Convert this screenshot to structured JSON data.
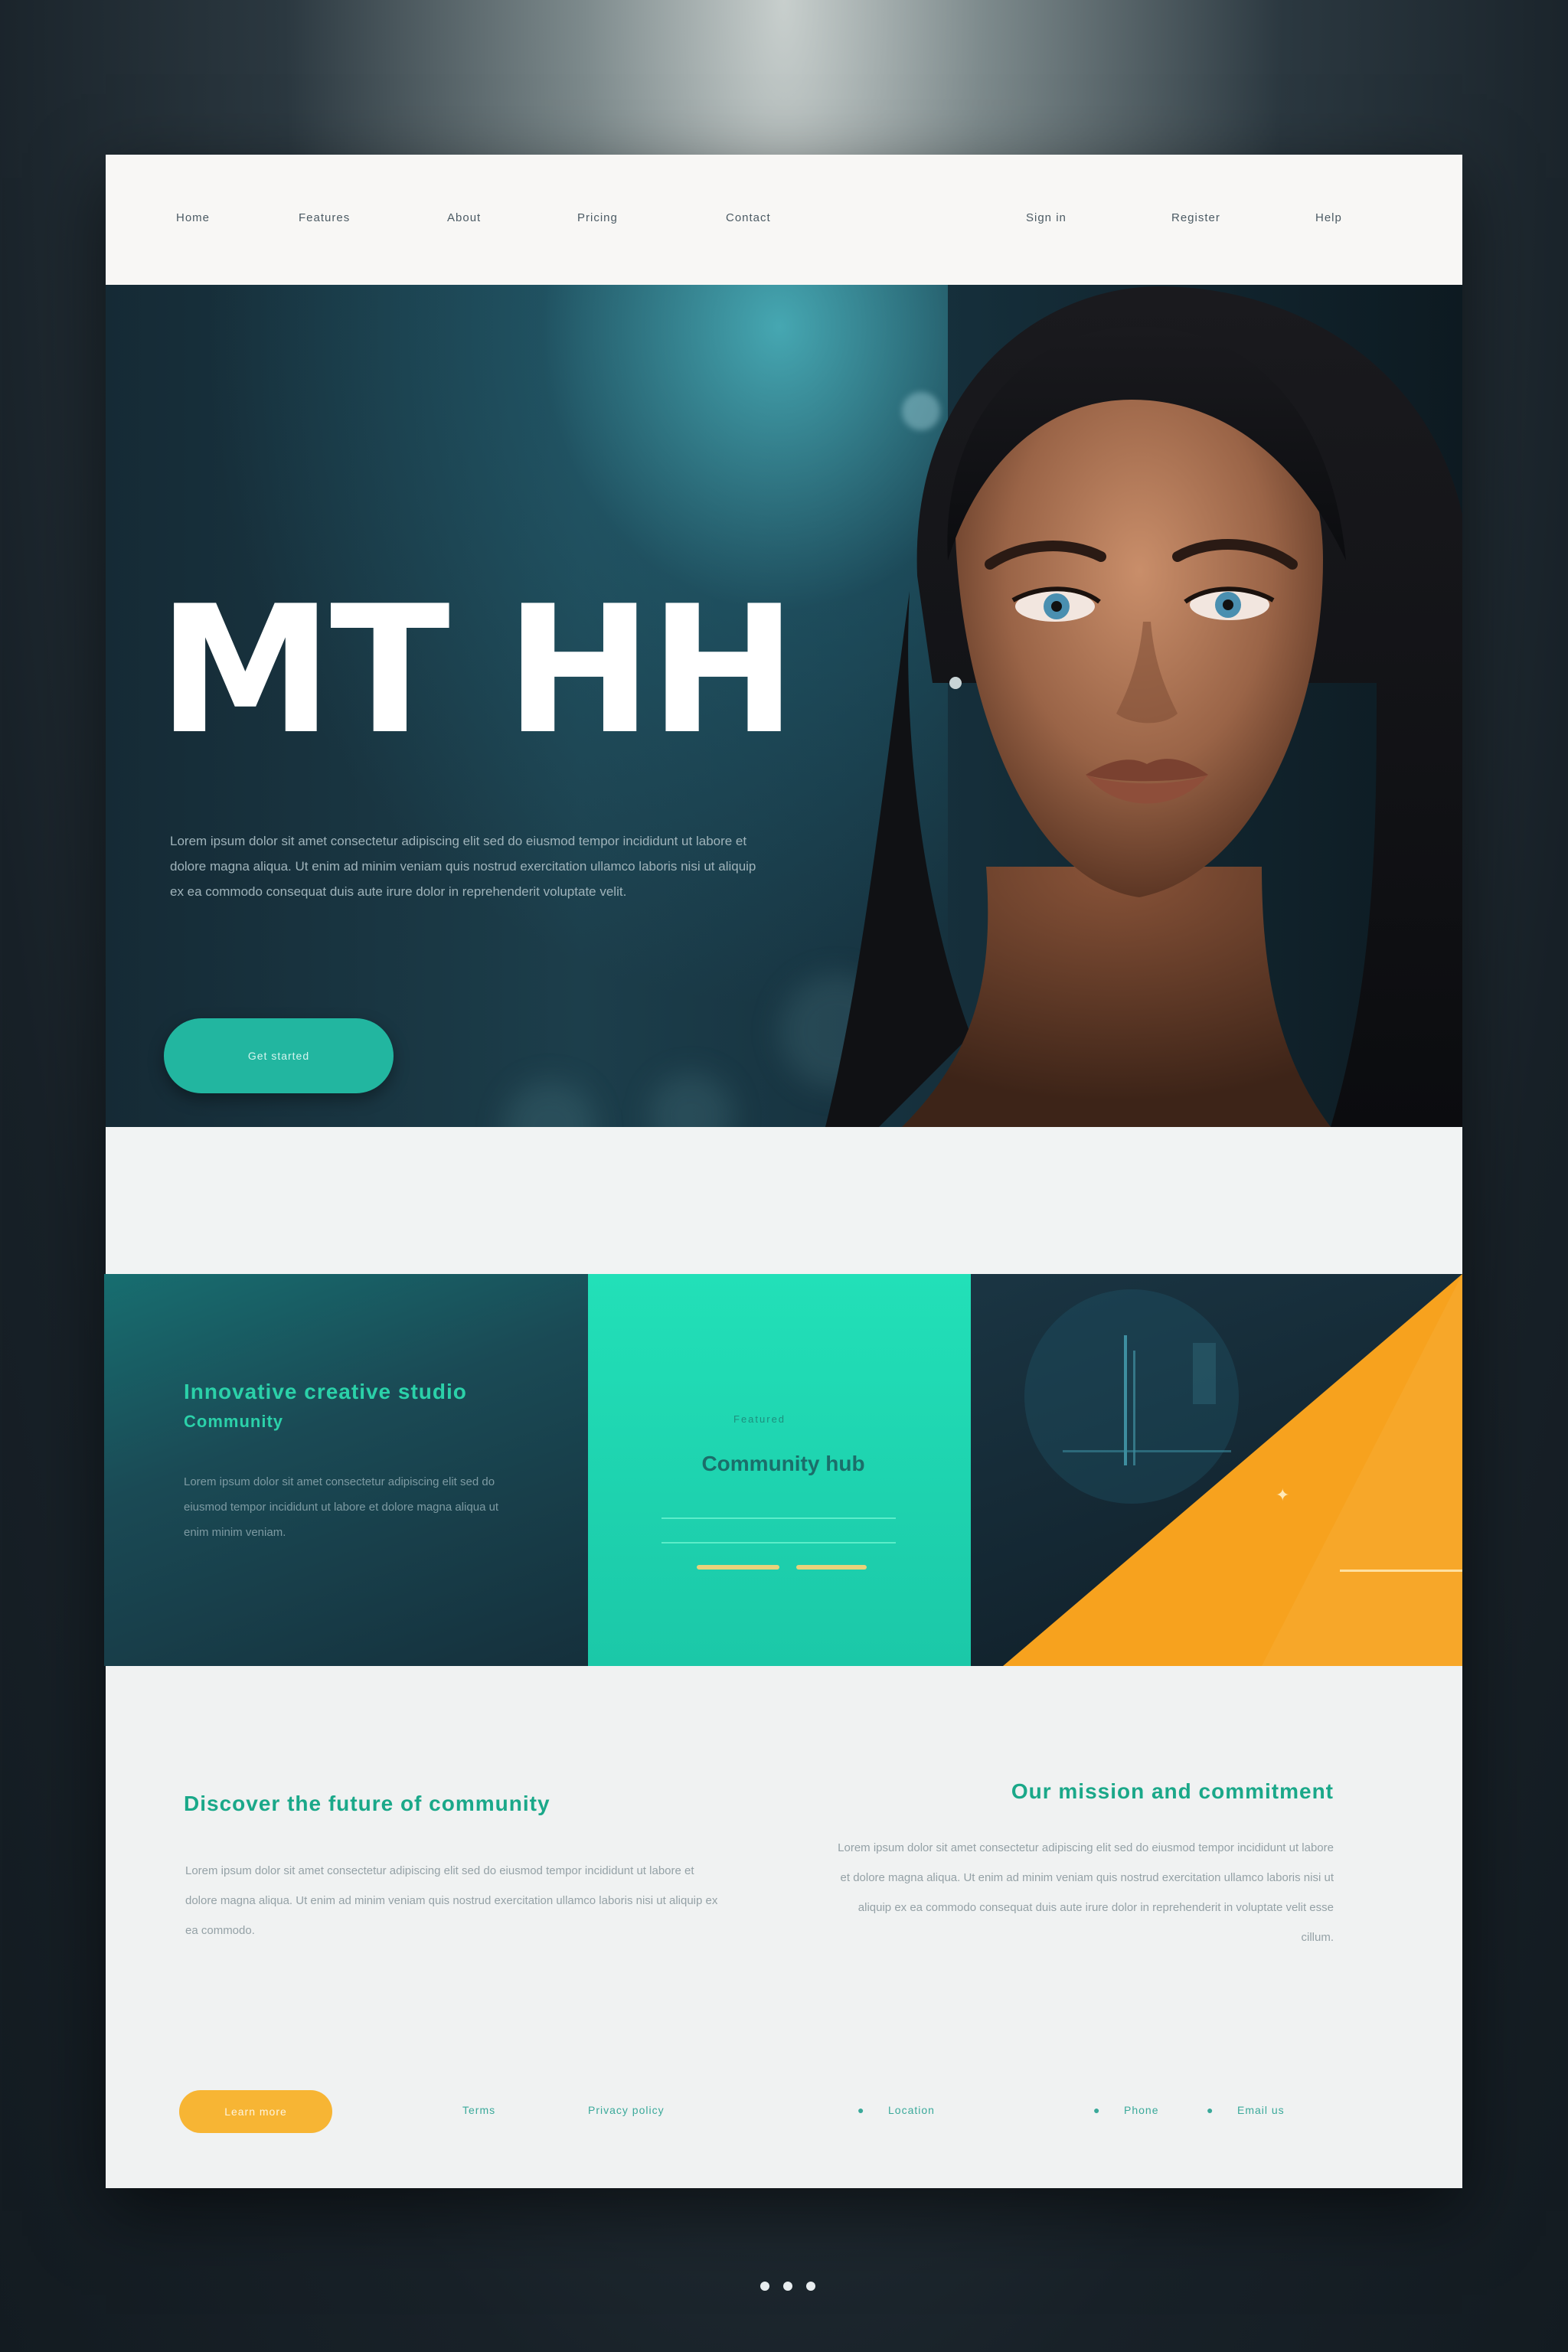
{
  "nav": {
    "left_items": [
      "Home",
      "Features",
      "About",
      "Pricing",
      "Contact"
    ],
    "right_items": [
      "Sign in",
      "Register",
      "Help"
    ]
  },
  "hero": {
    "title": "MT HH",
    "paragraph": "Lorem ipsum dolor sit amet consectetur adipiscing elit sed do eiusmod tempor incididunt ut labore et dolore magna aliqua. Ut enim ad minim veniam quis nostrud exercitation ullamco laboris nisi ut aliquip ex ea commodo consequat duis aute irure dolor in reprehenderit voluptate velit.",
    "cta_label": "Get started"
  },
  "cards": {
    "card1": {
      "title": "Innovative creative studio",
      "subtitle": "Community",
      "text": "Lorem ipsum dolor sit amet consectetur adipiscing elit sed do eiusmod tempor incididunt ut labore et dolore magna aliqua ut enim minim veniam."
    },
    "card2": {
      "kicker": "Featured",
      "title": "Community hub"
    },
    "card3": {
      "mark": "✦"
    }
  },
  "bottom": {
    "left_title": "Discover the future of community",
    "left_text": "Lorem ipsum dolor sit amet consectetur adipiscing elit sed do eiusmod tempor incididunt ut labore et dolore magna aliqua. Ut enim ad minim veniam quis nostrud exercitation ullamco laboris nisi ut aliquip ex ea commodo.",
    "right_title": "Our mission and commitment",
    "right_text": "Lorem ipsum dolor sit amet consectetur adipiscing elit sed do eiusmod tempor incididunt ut labore et dolore magna aliqua. Ut enim ad minim veniam quis nostrud exercitation ullamco laboris nisi ut aliquip ex ea commodo consequat duis aute irure dolor in reprehenderit in voluptate velit esse cillum.",
    "cta_label": "Learn more",
    "links": [
      "Terms",
      "Privacy policy"
    ],
    "contact": [
      "Location",
      "Phone",
      "Email us"
    ]
  },
  "colors": {
    "accent_teal": "#22b6a0",
    "accent_mint": "#22e0b8",
    "accent_orange": "#f7a21e",
    "dark": "#15303c"
  }
}
